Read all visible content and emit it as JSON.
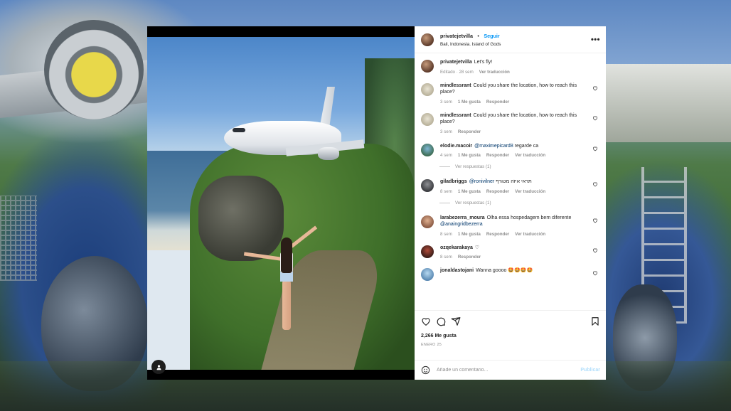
{
  "post": {
    "username": "privatejetvilla",
    "separator": "•",
    "follow_label": "Seguir",
    "location": "Bali, Indonesia. Island of Gods",
    "more_label": "•••",
    "caption": {
      "username": "privatejetvilla",
      "text": "Let's fly!",
      "edited": "Editado · 28 sem",
      "translate": "Ver traducción"
    },
    "comments": [
      {
        "username": "mindlessrant",
        "text": "Could you share the location, how to reach this place?",
        "time": "3 sem",
        "likes": "1 Me gusta",
        "reply": "Responder",
        "translate": ""
      },
      {
        "username": "mindlessrant",
        "text": "Could you share the location, how to reach this place?",
        "time": "3 sem",
        "likes": "",
        "reply": "Responder",
        "translate": ""
      },
      {
        "username": "elodie.macoir",
        "mention": "@maximepicard8",
        "text": " regarde ca",
        "time": "4 sem",
        "likes": "1 Me gusta",
        "reply": "Responder",
        "translate": "Ver traducción",
        "replies": "Ver respuestas (1)"
      },
      {
        "username": "giladbriggs",
        "mention": "@ronivilner",
        "text": " תראי איזה מטורף",
        "time": "8 sem",
        "likes": "1 Me gusta",
        "reply": "Responder",
        "translate": "Ver traducción",
        "replies": "Ver respuestas (1)"
      },
      {
        "username": "larabezerra_moura",
        "text": "Olha essa hospedagem bem diferente ",
        "mention": "@anaingridbezerra",
        "time": "8 sem",
        "likes": "1 Me gusta",
        "reply": "Responder",
        "translate": "Ver traducción"
      },
      {
        "username": "ozqekarakaya",
        "text": "♡",
        "time": "8 sem",
        "likes": "",
        "reply": "Responder",
        "translate": ""
      },
      {
        "username": "jonaldastojani",
        "text": "Wanna goooo 🤩🤩🤩🤩",
        "time": "",
        "likes": "",
        "reply": "",
        "translate": ""
      }
    ],
    "likes_count": "2,266 Me gusta",
    "date": "ENERO 25",
    "add_comment_placeholder": "Añade un comentario...",
    "publish_label": "Publicar"
  },
  "colors": {
    "link": "#0095f6",
    "mention": "#00376b",
    "muted": "#8e8e8e"
  },
  "icons": [
    "more-icon",
    "heart-icon",
    "comment-icon",
    "share-icon",
    "bookmark-icon",
    "emoji-icon",
    "user-tag-icon"
  ]
}
